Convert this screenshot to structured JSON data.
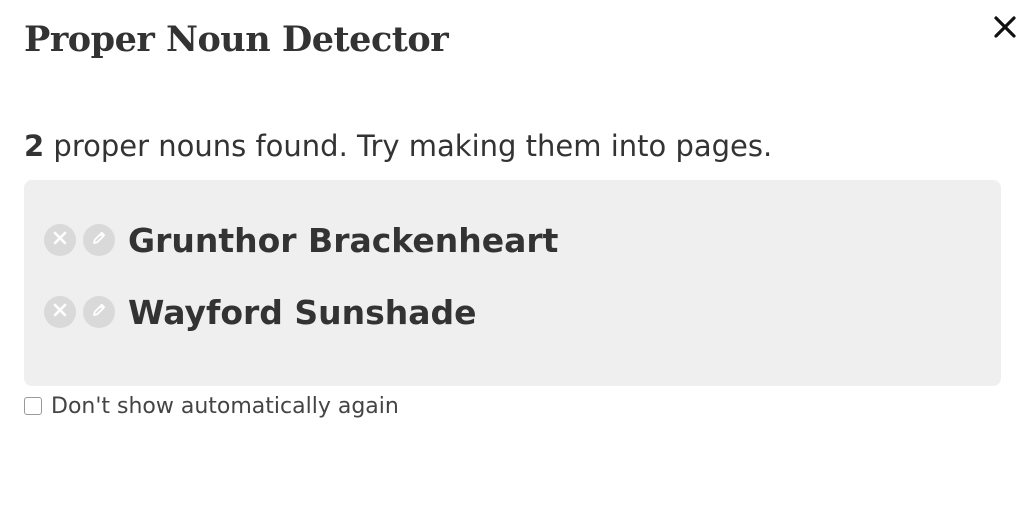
{
  "dialog": {
    "title": "Proper Noun Detector",
    "close_icon": "close-icon"
  },
  "summary": {
    "count": "2",
    "text": " proper nouns found. Try making them into pages."
  },
  "nouns": [
    {
      "label": "Grunthor Brackenheart",
      "remove_icon": "remove-circle-icon",
      "edit_icon": "pencil-icon"
    },
    {
      "label": "Wayford Sunshade",
      "remove_icon": "remove-circle-icon",
      "edit_icon": "pencil-icon"
    }
  ],
  "options": {
    "dont_show_label": "Don't show automatically again",
    "dont_show_checked": false
  },
  "colors": {
    "text": "#333333",
    "panel_bg": "#efefef",
    "icon_bg": "#d9d9d9",
    "icon_fg": "#ffffff"
  }
}
